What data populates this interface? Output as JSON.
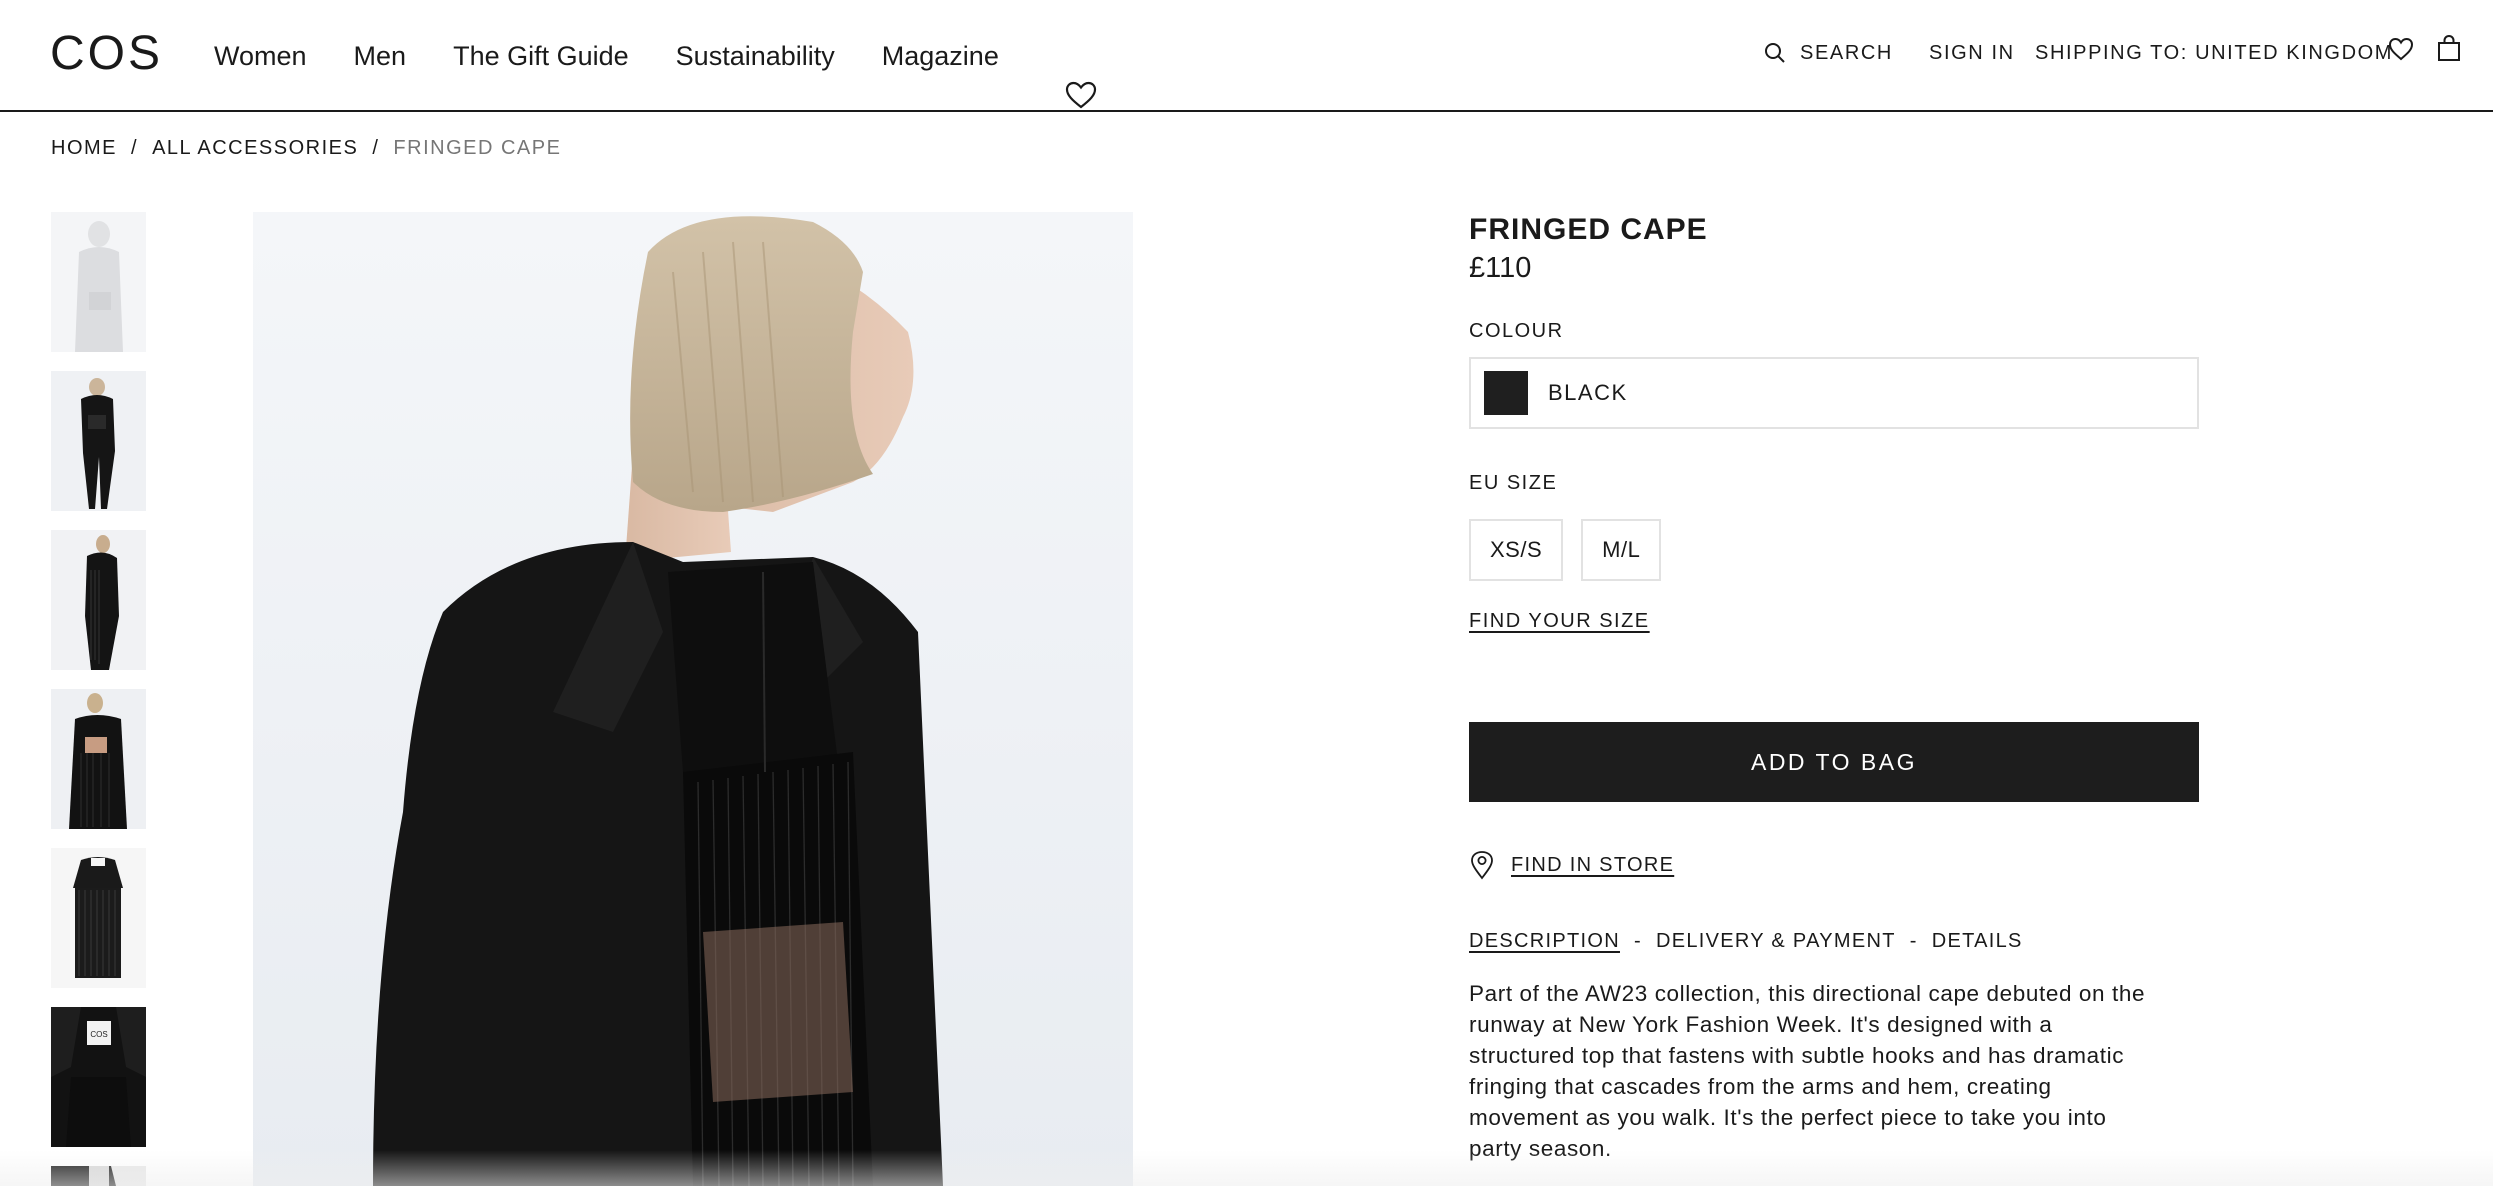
{
  "header": {
    "logo": "COS",
    "nav": [
      "Women",
      "Men",
      "The Gift Guide",
      "Sustainability",
      "Magazine"
    ],
    "search_label": "SEARCH",
    "signin_label": "SIGN IN",
    "shipping_label": "SHIPPING TO: UNITED KINGDOM",
    "icons": [
      "search-icon",
      "heart-icon",
      "bag-icon"
    ]
  },
  "breadcrumb": {
    "items": [
      "HOME",
      "ALL ACCESSORIES",
      "FRINGED CAPE"
    ],
    "separator": "/"
  },
  "product": {
    "title": "FRINGED CAPE",
    "price": "£110",
    "colour_label": "COLOUR",
    "colour_value": "BLACK",
    "colour_swatch": "#1f1f1f",
    "size_label": "EU SIZE",
    "sizes": [
      "XS/S",
      "M/L"
    ],
    "find_size": "FIND YOUR SIZE",
    "add_to_bag": "ADD TO BAG",
    "find_in_store": "FIND IN STORE",
    "tabs": [
      "DESCRIPTION",
      "DELIVERY & PAYMENT",
      "DETAILS"
    ],
    "tab_separator": "-",
    "description_lines": [
      "Part of the AW23 collection, this directional cape debuted on the",
      "runway at New York Fashion Week. It's designed with a",
      "structured top that fastens with subtle hooks and has dramatic",
      "fringing that cascades from the arms and hem, creating",
      "movement as you walk. It's the perfect piece to take you into",
      "party season."
    ]
  },
  "gallery": {
    "thumbnail_count": 7,
    "thumbnail_label_text": "COS"
  },
  "colors": {
    "text": "#1a1a1a",
    "muted": "#767676",
    "button_bg": "#1d1d1d",
    "border": "#e2e2e2"
  }
}
